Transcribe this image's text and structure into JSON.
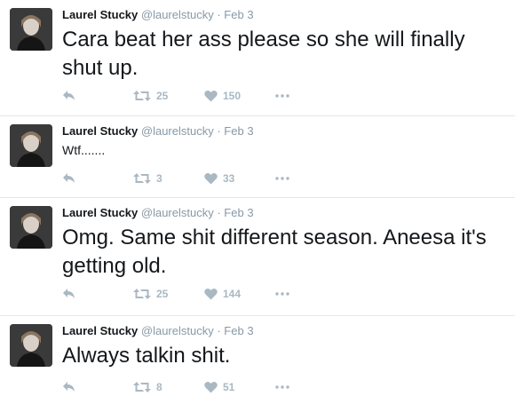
{
  "tweets": [
    {
      "author": "Laurel Stucky",
      "handle": "@laurelstucky",
      "date": "· Feb 3",
      "text": "Cara beat her ass please so she will finally shut up.",
      "retweets": "25",
      "likes": "150"
    },
    {
      "author": "Laurel Stucky",
      "handle": "@laurelstucky",
      "date": "· Feb 3",
      "text": "Wtf.......",
      "retweets": "3",
      "likes": "33"
    },
    {
      "author": "Laurel Stucky",
      "handle": "@laurelstucky",
      "date": "· Feb 3",
      "text": "Omg. Same shit different season. Aneesa it's getting old.",
      "retweets": "25",
      "likes": "144"
    },
    {
      "author": "Laurel Stucky",
      "handle": "@laurelstucky",
      "date": "· Feb 3",
      "text": "Always talkin shit.",
      "retweets": "8",
      "likes": "51"
    }
  ],
  "colors": {
    "action_gray": "#aab8c2",
    "meta_gray": "#8899a6",
    "text": "#14171a"
  },
  "icons": {
    "reply": "reply-arrow",
    "retweet": "retweet-arrows",
    "like": "heart",
    "more": "ellipsis"
  }
}
